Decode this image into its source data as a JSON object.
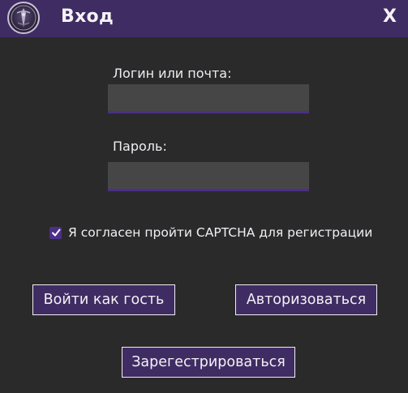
{
  "window": {
    "title": "Вход",
    "close_label": "X"
  },
  "form": {
    "login_label": "Логин или почта:",
    "login_value": "",
    "password_label": "Пароль:",
    "password_value": "",
    "captcha_checked": true,
    "captcha_label": "Я согласен пройти CAPTCHA для регистрации"
  },
  "buttons": {
    "guest_label": "Войти как гость",
    "login_label": "Авторизоваться",
    "register_label": "Зарегестрироваться"
  },
  "colors": {
    "titlebar": "#3f2c63",
    "accent": "#4b2f8a",
    "background": "#2b2a2b",
    "field": "#474647"
  },
  "icons": {
    "logo": "app-logo-icon",
    "checkbox": "checkmark-icon"
  }
}
